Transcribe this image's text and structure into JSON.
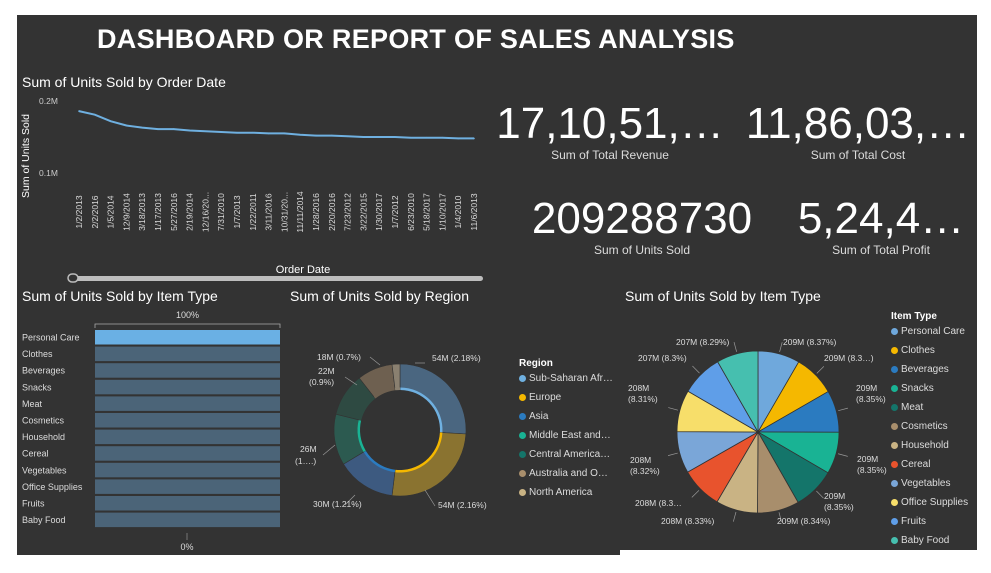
{
  "title": "DASHBOARD OR REPORT OF SALES ANALYSIS",
  "kpis": [
    {
      "value": "17,10,51,…",
      "label": "Sum of Total Revenue"
    },
    {
      "value": "11,86,03,…",
      "label": "Sum of Total Cost"
    },
    {
      "value": "209288730",
      "label": "Sum of Units Sold"
    },
    {
      "value": "5,24,4…",
      "label": "Sum of Total Profit"
    }
  ],
  "colors": {
    "background": "#333333",
    "line": "#6fb0e0",
    "bar_highlight": "#6ab0e4",
    "bar_base": "#4b6478"
  },
  "chart_data": [
    {
      "type": "line",
      "title": "Sum of Units Sold by Order Date",
      "xlabel": "Order Date",
      "ylabel": "Sum of Units Sold",
      "ytick_labels": [
        "0.2M",
        "0.1M"
      ],
      "ylim": [
        0.1,
        0.2
      ],
      "x": [
        "1/2/2013",
        "2/2/2016",
        "1/5/2014",
        "12/9/2014",
        "3/18/2013",
        "1/17/2013",
        "5/27/2016",
        "2/19/2014",
        "12/16/20...",
        "7/31/2010",
        "1/7/2013",
        "1/22/2011",
        "3/11/2016",
        "10/31/20...",
        "11/11/2014",
        "1/28/2016",
        "2/20/2016",
        "7/23/2012",
        "3/22/2015",
        "1/30/2017",
        "1/7/2012",
        "6/23/2010",
        "5/18/2017",
        "1/10/2017",
        "1/4/2010",
        "11/6/2013"
      ],
      "values": [
        0.186,
        0.181,
        0.172,
        0.166,
        0.163,
        0.161,
        0.161,
        0.159,
        0.158,
        0.157,
        0.156,
        0.156,
        0.155,
        0.155,
        0.153,
        0.152,
        0.152,
        0.151,
        0.15,
        0.15,
        0.15,
        0.149,
        0.149,
        0.149,
        0.148,
        0.148
      ],
      "grid": false
    },
    {
      "type": "bar",
      "orientation": "horizontal",
      "title": "Sum of Units Sold by Item Type",
      "categories": [
        "Personal Care",
        "Clothes",
        "Beverages",
        "Snacks",
        "Meat",
        "Cosmetics",
        "Household",
        "Cereal",
        "Vegetables",
        "Office Supplies",
        "Fruits",
        "Baby Food"
      ],
      "values": [
        100,
        100,
        100,
        100,
        100,
        100,
        100,
        100,
        100,
        100,
        100,
        100
      ],
      "top_label": "100%",
      "bottom_label": "0%",
      "highlighted": "Personal Care"
    },
    {
      "type": "pie",
      "variant": "donut",
      "title": "Sum of Units Sold by Region",
      "legend_title": "Region",
      "legend_position": "right",
      "categories": [
        "Sub-Saharan Afr…",
        "Europe",
        "Asia",
        "Middle East and…",
        "Central America…",
        "Australia and O…",
        "North America"
      ],
      "values": [
        54,
        54,
        30,
        26,
        22,
        18,
        4
      ],
      "data_labels": [
        "54M (2.18%)",
        "54M (2.16%)",
        "30M (1.21%)",
        "26M (1….)",
        "22M (0.9%)",
        "18M (0.7%)",
        ""
      ],
      "colors": [
        "#4a6680",
        "#8a7330",
        "#3d5a80",
        "#2c5a50",
        "#2e4a42",
        "#6e6050",
        "#8a8070"
      ]
    },
    {
      "type": "pie",
      "title": "Sum of Units Sold by Item Type",
      "legend_title": "Item Type",
      "legend_position": "right",
      "categories": [
        "Personal Care",
        "Clothes",
        "Beverages",
        "Snacks",
        "Meat",
        "Cosmetics",
        "Household",
        "Cereal",
        "Vegetables",
        "Office Supplies",
        "Fruits",
        "Baby Food"
      ],
      "values": [
        8.37,
        8.3,
        8.35,
        8.35,
        8.35,
        8.34,
        8.33,
        8.3,
        8.32,
        8.31,
        8.3,
        8.29
      ],
      "data_labels": [
        "209M (8.37%)",
        "209M (8.3…)",
        "209M (8.35%)",
        "209M (8.35%)",
        "209M (8.35%)",
        "209M (8.34%)",
        "208M (8.33%)",
        "208M (8.3…)",
        "208M (8.32%)",
        "208M (8.31%)",
        "207M (8.3%)",
        "207M (8.29%)"
      ],
      "colors": [
        "#6fa8dc",
        "#f5b800",
        "#2b7bc0",
        "#19b394",
        "#14756a",
        "#a88e6c",
        "#c9b384",
        "#e8532d",
        "#7aa6d8",
        "#f7de6a",
        "#5f9ee8",
        "#46bfaf"
      ]
    }
  ]
}
